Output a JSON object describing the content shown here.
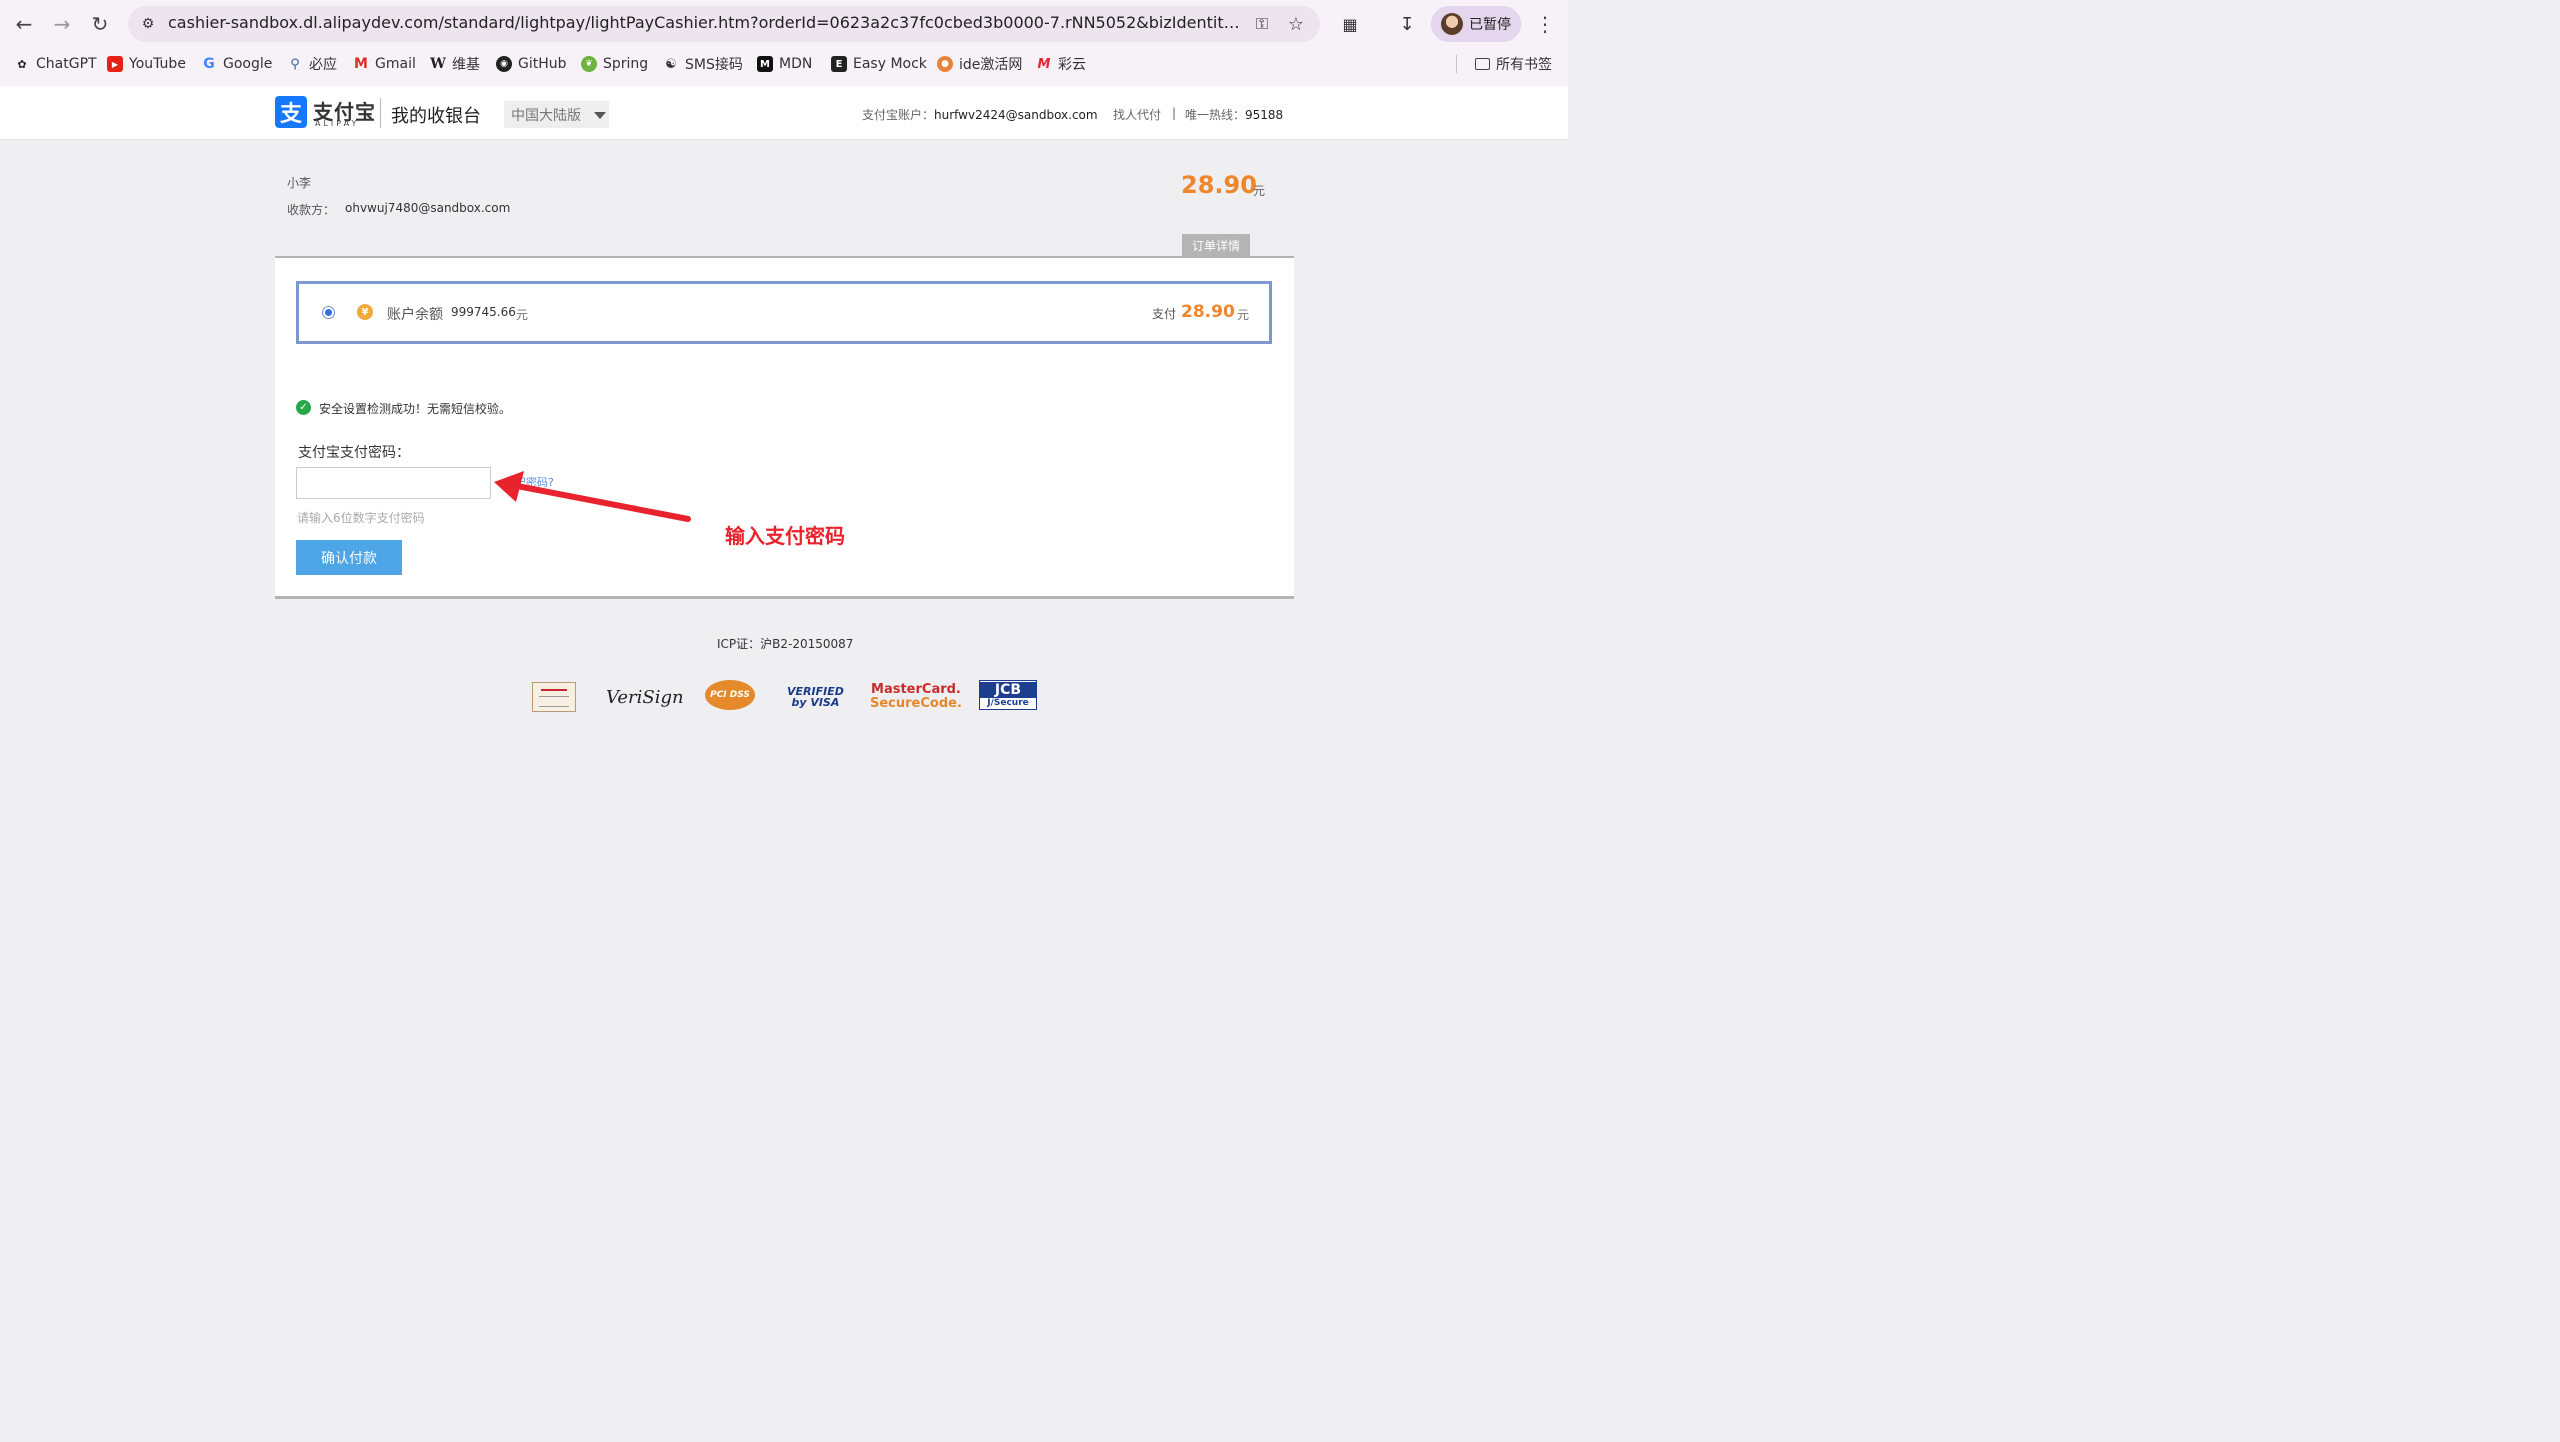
{
  "browser": {
    "url": "cashier-sandbox.dl.alipaydev.com/standard/lightpay/lightPayCashier.htm?orderId=0623a2c37fc0cbed3b0000-7.rNN5052&bizIdentity=trade20001&...",
    "profile_label": "已暂停",
    "bookmarks": [
      {
        "label": "ChatGPT",
        "icon": "chatgpt-icon"
      },
      {
        "label": "YouTube",
        "icon": "youtube-icon"
      },
      {
        "label": "Google",
        "icon": "google-icon"
      },
      {
        "label": "必应",
        "icon": "bing-icon"
      },
      {
        "label": "Gmail",
        "icon": "gmail-icon"
      },
      {
        "label": "维基",
        "icon": "wikipedia-icon"
      },
      {
        "label": "GitHub",
        "icon": "github-icon"
      },
      {
        "label": "Spring",
        "icon": "spring-icon"
      },
      {
        "label": "SMS接码",
        "icon": "sms-icon"
      },
      {
        "label": "MDN",
        "icon": "mdn-icon"
      },
      {
        "label": "Easy Mock",
        "icon": "easymock-icon"
      },
      {
        "label": "ide激活网",
        "icon": "ide-icon"
      },
      {
        "label": "彩云",
        "icon": "caiyun-icon"
      }
    ],
    "all_bookmarks_label": "所有书签"
  },
  "header": {
    "logo_text": "支付宝",
    "logo_sub": "ALIPAY",
    "title": "我的收银台",
    "region": "中国大陆版",
    "account_label": "支付宝账户：",
    "account_value": "hurfwv2424@sandbox.com",
    "find_proxy": "找人代付",
    "separator": "|",
    "hotline_label": "唯一热线：",
    "hotline_value": "95188"
  },
  "order": {
    "merchant": "小李",
    "payee_label": "收款方：",
    "payee_value": "ohvwuj7480@sandbox.com",
    "amount": "28.90",
    "unit": "元",
    "detail_tab": "订单详情"
  },
  "payment": {
    "method_label": "账户余额",
    "balance": "999745.66",
    "balance_unit": "元",
    "pay_label": "支付",
    "pay_amount": "28.90",
    "pay_unit": "元",
    "security_message": "安全设置检测成功！无需短信校验。",
    "password_label": "支付宝支付密码：",
    "forgot_link": "忘记密码?",
    "password_hint": "请输入6位数字支付密码",
    "confirm_button": "确认付款"
  },
  "annotation": {
    "text": "输入支付密码",
    "color": "#e8232d"
  },
  "footer": {
    "icp": "ICP证：沪B2-20150087",
    "badges": {
      "verisign": "VeriSign",
      "pcidss": "PCI DSS",
      "visa_line1": "VERIFIED",
      "visa_line2": "by VISA",
      "mc_line1": "MasterCard.",
      "mc_line2": "SecureCode.",
      "jcb_line1": "JCB",
      "jcb_line2": "J/Secure"
    }
  },
  "colors": {
    "accent_orange": "#f0862b",
    "button_blue": "#4ea6e6",
    "alipay_blue": "#1677ff"
  }
}
